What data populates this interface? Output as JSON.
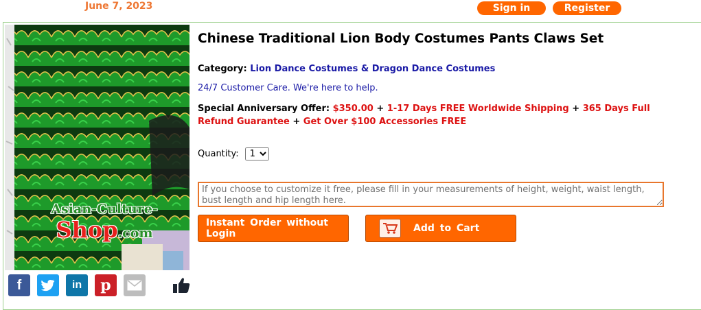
{
  "header": {
    "date": "June 7, 2023",
    "sign_in": "Sign in",
    "register": "Register"
  },
  "watermark": {
    "part1": "Asian-Culture-",
    "part2": "Shop",
    "part3": ".com"
  },
  "product": {
    "title": "Chinese Traditional Lion Body Costumes Pants Claws Set",
    "category_label": "Category:",
    "category_value": "Lion Dance Costumes & Dragon Dance Costumes",
    "customer_care": "24/7 Customer Care. We're here to help.",
    "offer": {
      "label": "Special Anniversary Offer:",
      "price": "$350.00",
      "plus": "+",
      "shipping": "1-17 Days FREE Worldwide Shipping",
      "refund": "365 Days Full Refund Guarantee",
      "accessories": "Get Over $100 Accessories FREE"
    },
    "quantity_label": "Quantity:",
    "quantity_value": "1",
    "customize_placeholder": "If you choose to customize it free, please fill in your measurements of height, weight, waist length, bust length and hip length here."
  },
  "actions": {
    "instant_order": "Instant Order without Login",
    "add_to_cart": "Add to Cart"
  },
  "social": [
    {
      "icon": "facebook-icon",
      "glyph": "f",
      "color": "#3b5998"
    },
    {
      "icon": "twitter-icon",
      "glyph": "t",
      "color": "#1da1f2"
    },
    {
      "icon": "linkedin-icon",
      "glyph": "in",
      "color": "#0e76a8"
    },
    {
      "icon": "pinterest-icon",
      "glyph": "p",
      "color": "#cb2027"
    },
    {
      "icon": "email-icon",
      "glyph": "",
      "color": "#bdbdbd"
    }
  ],
  "colors": {
    "accent": "#ff6600",
    "date": "#ee7733",
    "link": "#1a1aa6",
    "offer_red": "#dd1111",
    "frame": "#9ccf8c"
  }
}
